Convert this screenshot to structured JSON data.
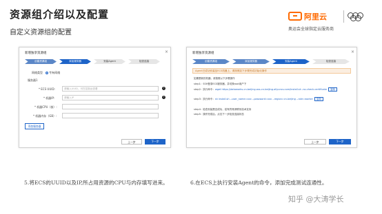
{
  "slide": {
    "title": "资源组介绍以及配置",
    "subtitle": "自定义资源组的配置"
  },
  "logo": {
    "brand": "阿里云",
    "caption": "奥运会全球指定云服务商"
  },
  "left_dialog": {
    "title": "新增独享资源组",
    "close": "×",
    "steps": [
      "创建资源组",
      "添加服务器",
      "安装Agent",
      "检查连接"
    ],
    "active_step": 1,
    "radio_label": "网络类型",
    "radio_options": [
      "专有网络"
    ],
    "section_label": "服务器1",
    "fields": [
      {
        "label": "* ECS UUID:",
        "placeholder": "请输入UUID，可在控制台查看"
      },
      {
        "label": "* 机器IP:",
        "placeholder": "请输入IP"
      },
      {
        "label": "* 机器CPU（核）:",
        "placeholder": ""
      },
      {
        "label": "* 机器内存（GB）:",
        "placeholder": ""
      }
    ],
    "help_mark": "?",
    "add_button": "添加服务器",
    "prev_button": "上一步",
    "next_button": "下一步"
  },
  "right_dialog": {
    "title": "新增独享资源组",
    "close": "×",
    "steps": [
      "创建资源组",
      "添加服务器",
      "安装Agent",
      "检查连接"
    ],
    "active_step": 2,
    "info": "Agent已成功安装至ECS机器上，请按照如下步骤完成初始化操作",
    "heading": "如果是新的机器，请按照以下步骤操作",
    "lines": [
      {
        "text": "step1：SSH登录ECS服务器，并切换root用户下",
        "link": "",
        "copy": ""
      },
      {
        "text": "step2：执行命令：",
        "link": "wget https://dataworks-cn-beijing.oss-cn-beijing.aliyuncs.com/install.sh -no-check-certificate",
        "copy": "复制"
      },
      {
        "text": "step3：执行命令：",
        "link": "sh install.sh --user_name=xxx --password=xxx --region=cn-beijing --role=worker",
        "copy": "复制"
      },
      {
        "text": "step4：检查安装是否成功，若有异常请联系技术支持",
        "link": "",
        "copy": ""
      },
      {
        "text": "step5：操作完成后，点击下一步检查连接状态",
        "link": "",
        "copy": ""
      }
    ],
    "prev_button": "上一步",
    "next_button": "下一步"
  },
  "captions": {
    "left": "5.将ECS的UUID以及IP,所占用资源的CPU与内存填写进来。",
    "right": "6.在ECS上执行安装Agent的命令，添加完成测试连通性。"
  },
  "watermark": "知乎 @大涛学长"
}
